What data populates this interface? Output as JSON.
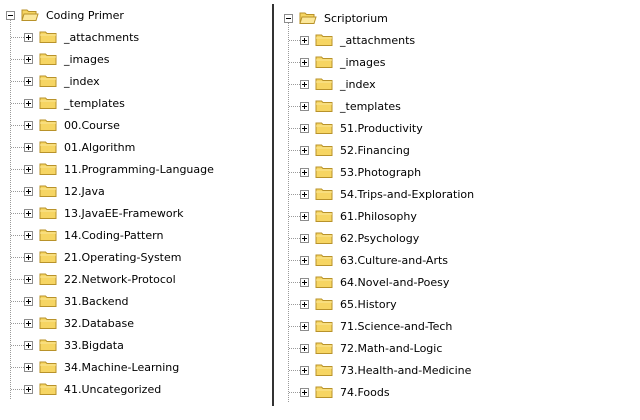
{
  "left_tree": {
    "root_label": "Coding Primer",
    "items": [
      {
        "label": "_attachments"
      },
      {
        "label": "_images"
      },
      {
        "label": "_index"
      },
      {
        "label": "_templates"
      },
      {
        "label": "00.Course"
      },
      {
        "label": "01.Algorithm"
      },
      {
        "label": "11.Programming-Language"
      },
      {
        "label": "12.Java"
      },
      {
        "label": "13.JavaEE-Framework"
      },
      {
        "label": "14.Coding-Pattern"
      },
      {
        "label": "21.Operating-System"
      },
      {
        "label": "22.Network-Protocol"
      },
      {
        "label": "31.Backend"
      },
      {
        "label": "32.Database"
      },
      {
        "label": "33.Bigdata"
      },
      {
        "label": "34.Machine-Learning"
      },
      {
        "label": "41.Uncategorized"
      }
    ]
  },
  "right_tree": {
    "root_label": "Scriptorium",
    "items": [
      {
        "label": "_attachments"
      },
      {
        "label": "_images"
      },
      {
        "label": "_index"
      },
      {
        "label": "_templates"
      },
      {
        "label": "51.Productivity"
      },
      {
        "label": "52.Financing"
      },
      {
        "label": "53.Photograph"
      },
      {
        "label": "54.Trips-and-Exploration"
      },
      {
        "label": "61.Philosophy"
      },
      {
        "label": "62.Psychology"
      },
      {
        "label": "63.Culture-and-Arts"
      },
      {
        "label": "64.Novel-and-Poesy"
      },
      {
        "label": "65.History"
      },
      {
        "label": "71.Science-and-Tech"
      },
      {
        "label": "72.Math-and-Logic"
      },
      {
        "label": "73.Health-and-Medicine"
      },
      {
        "label": "74.Foods"
      }
    ]
  },
  "colors": {
    "folder_fill": "#f6d563",
    "folder_stroke": "#b8922a"
  }
}
